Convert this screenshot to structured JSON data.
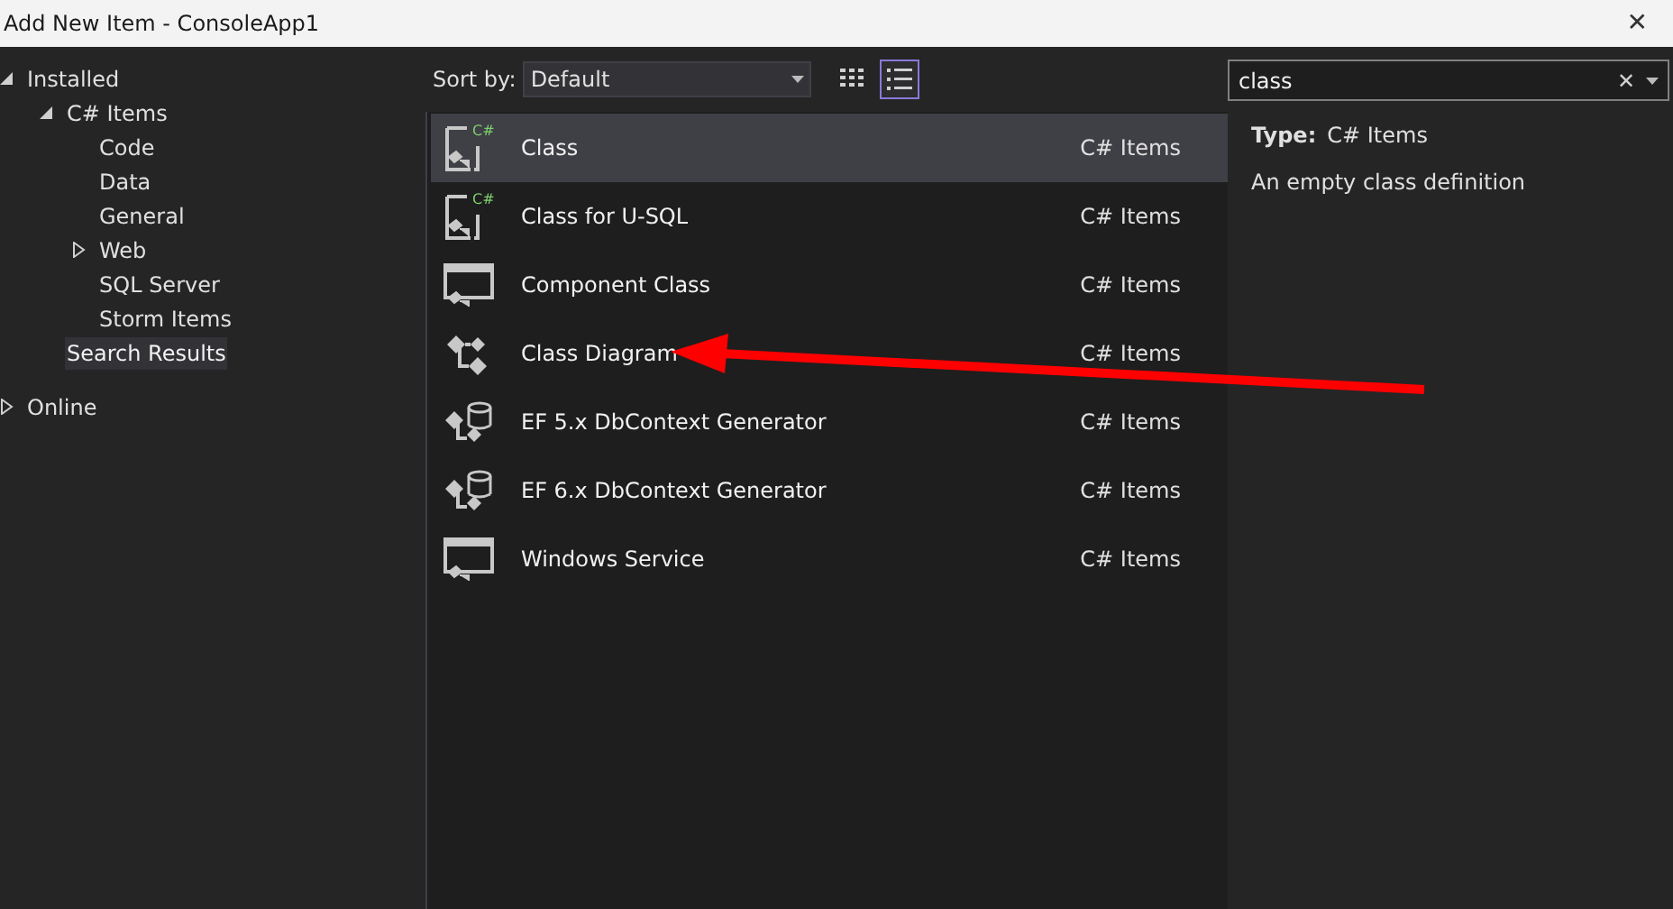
{
  "window": {
    "title": "Add New Item - ConsoleApp1",
    "close": "✕"
  },
  "tree": [
    {
      "label": "Installed",
      "expanded": true,
      "selected": false,
      "children": [
        {
          "label": "C# Items",
          "expanded": true,
          "selected": false,
          "children": [
            {
              "label": "Code",
              "selected": false
            },
            {
              "label": "Data",
              "selected": false
            },
            {
              "label": "General",
              "selected": false
            },
            {
              "label": "Web",
              "expanded": false,
              "selected": false
            },
            {
              "label": "SQL Server",
              "selected": false
            },
            {
              "label": "Storm Items",
              "selected": false
            }
          ]
        },
        {
          "label": "Search Results",
          "selected": true
        }
      ]
    },
    {
      "label": "Online",
      "expanded": false,
      "selected": false
    }
  ],
  "toolbar": {
    "sort_label": "Sort by:",
    "sort_value": "Default",
    "views": [
      {
        "kind": "grid",
        "selected": false
      },
      {
        "kind": "list",
        "selected": true
      }
    ]
  },
  "items": [
    {
      "name": "Class",
      "type": "C# Items",
      "kind": "class",
      "badge": "C#",
      "selected": true
    },
    {
      "name": "Class for U-SQL",
      "type": "C# Items",
      "kind": "class",
      "badge": "C#",
      "selected": false
    },
    {
      "name": "Component Class",
      "type": "C# Items",
      "kind": "component",
      "selected": false
    },
    {
      "name": "Class Diagram",
      "type": "C# Items",
      "kind": "diagram",
      "selected": false
    },
    {
      "name": "EF 5.x DbContext Generator",
      "type": "C# Items",
      "kind": "ef",
      "selected": false
    },
    {
      "name": "EF 6.x DbContext Generator",
      "type": "C# Items",
      "kind": "ef",
      "selected": false
    },
    {
      "name": "Windows Service",
      "type": "C# Items",
      "kind": "component",
      "selected": false
    }
  ],
  "search": {
    "value": "class",
    "clear": "✕"
  },
  "details": {
    "type_label": "Type:",
    "type_value": "C# Items",
    "description": "An empty class definition"
  }
}
